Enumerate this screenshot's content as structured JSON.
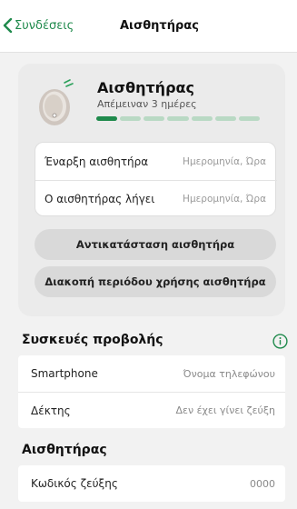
{
  "navbar": {
    "back_label": "Συνδέσεις",
    "title": "Αισθητήρας"
  },
  "sensor": {
    "name": "Αισθητήρας",
    "remaining": "Απέμειναν 3 ημέρες",
    "progress": {
      "segments_total": 7,
      "segments_filled": 1
    },
    "start": {
      "label": "Έναρξη αισθητήρα",
      "value": "Ημερομηνία, Ώρα"
    },
    "expires": {
      "label": "Ο αισθητήρας λήγει",
      "value": "Ημερομηνία, Ώρα"
    },
    "replace_label": "Αντικατάσταση αισθητήρα",
    "stop_label": "Διακοπή περιόδου χρήσης αισθητήρα"
  },
  "display_devices": {
    "title": "Συσκευές προβολής",
    "items": [
      {
        "label": "Smartphone",
        "value": "Όνομα τηλεφώνου"
      },
      {
        "label": "Δέκτης",
        "value": "Δεν έχει γίνει ζεύξη"
      }
    ]
  },
  "sensor_section": {
    "title": "Αισθητήρας",
    "pairing": {
      "label": "Κωδικός ζεύξης",
      "value": "0000"
    }
  },
  "colors": {
    "accent": "#1f8a4c",
    "progress_track": "#b9d9c4",
    "background": "#f2f2f2"
  },
  "icons": {
    "back": "chevron-left-icon",
    "info": "info-circle-icon",
    "sensor": "sensor-device-icon"
  }
}
